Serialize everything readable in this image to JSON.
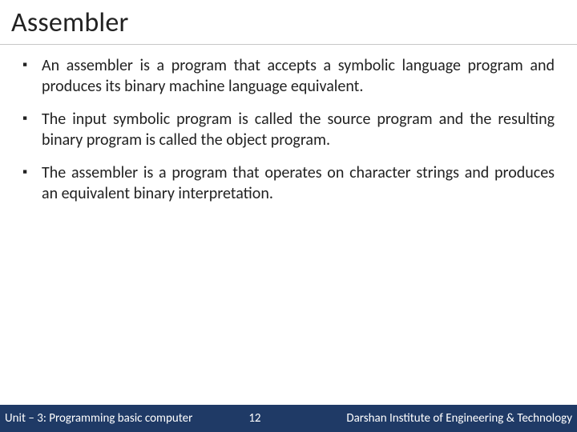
{
  "title": "Assembler",
  "bullets": [
    "An assembler is a program that accepts a symbolic language program and produces its binary machine language equivalent.",
    "The input symbolic program is called the source program and the resulting binary program is called the object program.",
    "The assembler is a program that operates on character strings and produces an equivalent binary interpretation."
  ],
  "footer": {
    "left": "Unit – 3: Programming basic computer",
    "page": "12",
    "right": "Darshan Institute of Engineering & Technology"
  }
}
